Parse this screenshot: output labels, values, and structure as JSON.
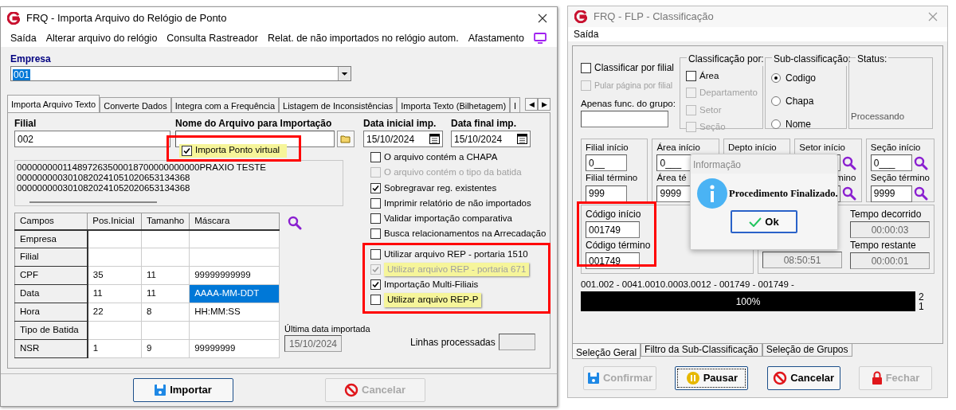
{
  "import_window": {
    "title": "FRQ - Importa Arquivo do Relógio de Ponto",
    "menu": [
      "Saída",
      "Alterar arquivo do relógio",
      "Consulta Rastreador",
      "Relat. de não importados no relógio autom.",
      "Afastamento"
    ],
    "company": {
      "label": "Empresa",
      "value": "001"
    },
    "tabs": [
      {
        "label": "Importa Arquivo Texto",
        "selected": true
      },
      {
        "label": "Converte Dados",
        "selected": false
      },
      {
        "label": "Integra com a Frequência",
        "selected": false
      },
      {
        "label": "Listagem de Inconsistências",
        "selected": false
      },
      {
        "label": "Importa Texto (Bilhetagem)",
        "selected": false
      },
      {
        "label": "I",
        "selected": false
      }
    ],
    "tab_scroll": [
      "◀",
      "▶"
    ],
    "branch": {
      "label": "Filial",
      "value": "002"
    },
    "file": {
      "label": "Nome do Arquivo para Importação"
    },
    "start_date": {
      "label": "Data inicial imp.",
      "value": "15/10/2024"
    },
    "end_date": {
      "label": "Data final imp.",
      "value": "15/10/2024"
    },
    "virtual_option": {
      "label": "Importa Ponto virtual",
      "checked": true,
      "annotated": true
    },
    "preview_lines": [
      "000000000114897263500018700000000000PRAXIO TESTE",
      "0000000003010820241051020653134368",
      "0000000003010820241052020653134368"
    ],
    "options": [
      {
        "label": "O arquivo contém a CHAPA",
        "checked": false,
        "disabled": false
      },
      {
        "label": "O arquivo contém o tipo da batida",
        "checked": false,
        "disabled": true
      },
      {
        "label": "Sobregravar reg. existentes",
        "checked": true,
        "disabled": false
      },
      {
        "label": "Imprimir relatório de não importados",
        "checked": false,
        "disabled": false
      },
      {
        "label": "Validar importação comparativa",
        "checked": false,
        "disabled": false
      },
      {
        "label": "Busca relacionamentos na Arrecadação",
        "checked": false,
        "disabled": false
      }
    ],
    "rep_options": {
      "annotated": true,
      "items": [
        {
          "label": "Utilizar arquivo REP - portaria 1510",
          "checked": false,
          "disabled": false,
          "highlighted": false
        },
        {
          "label": "Utilizar arquivo REP - portaria 671",
          "checked": true,
          "disabled": true,
          "highlighted": true
        },
        {
          "label": "Importação Multi-Filiais",
          "checked": true,
          "disabled": false,
          "highlighted": false
        },
        {
          "label": "Utilizar arquivo REP-P",
          "checked": false,
          "disabled": false,
          "highlighted": true
        }
      ]
    },
    "grid": {
      "columns": [
        "Campos",
        "Pos.Inicial",
        "Tamanho",
        "Máscara"
      ],
      "rows": [
        {
          "cells": [
            {
              "text": "Empresa",
              "selected": false
            },
            {
              "selected": false
            },
            {
              "selected": false
            },
            {
              "selected": false
            }
          ]
        },
        {
          "cells": [
            {
              "text": "Filial",
              "selected": false
            },
            {
              "selected": false
            },
            {
              "selected": false
            },
            {
              "selected": false
            }
          ]
        },
        {
          "cells": [
            {
              "text": "CPF",
              "selected": false
            },
            {
              "text": "35",
              "selected": false
            },
            {
              "text": "11",
              "selected": false
            },
            {
              "text": "99999999999",
              "selected": false
            }
          ]
        },
        {
          "cells": [
            {
              "text": "Data",
              "selected": false
            },
            {
              "text": "11",
              "selected": false
            },
            {
              "text": "11",
              "selected": false
            },
            {
              "text": "AAAA-MM-DDT",
              "selected": true
            }
          ]
        },
        {
          "cells": [
            {
              "text": "Hora",
              "selected": false
            },
            {
              "text": "22",
              "selected": false
            },
            {
              "text": "8",
              "selected": false
            },
            {
              "text": "HH:MM:SS",
              "selected": false
            }
          ]
        },
        {
          "cells": [
            {
              "text": "Tipo de Batida",
              "selected": false
            },
            {
              "selected": false
            },
            {
              "selected": false
            },
            {
              "selected": false
            }
          ]
        },
        {
          "cells": [
            {
              "text": "NSR",
              "selected": false
            },
            {
              "text": "1",
              "selected": false
            },
            {
              "text": "9",
              "selected": false
            },
            {
              "text": "99999999",
              "selected": false
            }
          ]
        }
      ]
    },
    "last_import": {
      "label": "Última data importada",
      "value": "15/10/2024"
    },
    "lines_processed": {
      "label": "Linhas processadas"
    },
    "buttons": [
      {
        "label": "Importar",
        "kind": "save",
        "disabled": false
      },
      {
        "label": "Cancelar",
        "kind": "cancel",
        "disabled": true
      }
    ]
  },
  "classification_window": {
    "title": "FRQ - FLP - Classificação",
    "menu": [
      "Saída"
    ],
    "by_branch": {
      "label": "Classificar por filial",
      "checked": false,
      "disabled": false
    },
    "skip_page": {
      "label": "Pular página por filial",
      "checked": false,
      "disabled": true
    },
    "group_only": {
      "label": "Apenas func. do grupo:"
    },
    "classification": {
      "title": "Classificação  por:",
      "options": [
        {
          "label": "Área",
          "checked": false,
          "disabled": false
        },
        {
          "label": "Departamento",
          "checked": false,
          "disabled": true
        },
        {
          "label": "Setor",
          "checked": false,
          "disabled": true
        },
        {
          "label": "Seção",
          "checked": false,
          "disabled": true
        }
      ]
    },
    "sub_classification": {
      "title": "Sub-classificação:",
      "options": [
        {
          "label": "Codigo",
          "selected": true
        },
        {
          "label": "Chapa",
          "selected": false
        },
        {
          "label": "Nome",
          "selected": false
        }
      ]
    },
    "status": {
      "title": "Status:",
      "text": "Processando"
    },
    "ranges": [
      {
        "start_label": "Filial início",
        "start_value": "0__",
        "end_label": "Filial término",
        "end_value": "999",
        "search": false
      },
      {
        "start_label": "Área início",
        "start_value": "0___",
        "end_label": "Área té",
        "end_value": "9999"
      },
      {
        "start_label": "Depto início"
      },
      {
        "start_label": "Setor início",
        "end_label": "mino",
        "search": true
      },
      {
        "start_label": "Seção início",
        "start_value": "0___",
        "end_label": "Seção término",
        "end_value": "9999",
        "search": true
      }
    ],
    "code_range": {
      "start_label": "Código início",
      "start_value": "001749",
      "end_label": "Código término",
      "end_value": "001749",
      "annotated": true
    },
    "estimate": {
      "value": "08:50:51"
    },
    "elapsed": {
      "label": "Tempo decorrido",
      "value": "00:00:03"
    },
    "remaining": {
      "label": "Tempo restante",
      "value": "00:00:01"
    },
    "progress": {
      "text": "001.002 - 0041.0010.0003.0012 - 001749 - 001749 -",
      "level": 1,
      "label": "100%",
      "counts": [
        "2",
        "1"
      ]
    },
    "tabs": [
      {
        "label": "Seleção Geral",
        "selected": true
      },
      {
        "label": "Filtro da Sub-Classificação",
        "selected": false
      },
      {
        "label": "Seleção de Grupos",
        "selected": false
      }
    ],
    "buttons": [
      {
        "label": "Confirmar",
        "kind": "save",
        "disabled": true,
        "focused": false
      },
      {
        "label": "Pausar",
        "kind": "pause",
        "disabled": false,
        "focused": true
      },
      {
        "label": "Cancelar",
        "kind": "cancel",
        "disabled": false,
        "focused": false
      },
      {
        "label": "Fechar",
        "kind": "lock",
        "disabled": true,
        "focused": false
      }
    ],
    "dialog": {
      "title": "Informação",
      "message": "Procedimento Finalizado.",
      "button": "Ok"
    }
  }
}
